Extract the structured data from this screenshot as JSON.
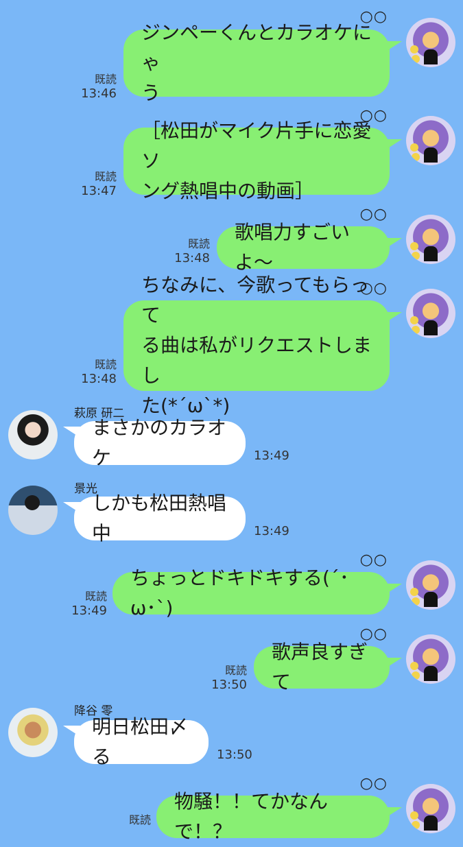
{
  "user_mark": "○○",
  "read_label": "既読",
  "messages": [
    {
      "text": "ジンペーくんとカラオケにゃ\nう",
      "time": "13:46"
    },
    {
      "text": "［松田がマイク片手に恋愛ソ\nング熱唱中の動画］",
      "time": "13:47"
    },
    {
      "text": "歌唱力すごいよ〜",
      "time": "13:48"
    },
    {
      "text": "ちなみに、今歌ってもらって\nる曲は私がリクエストしまし\nた(*´ω`*)",
      "time": "13:48"
    },
    {
      "sender": "萩原 研二",
      "text": "まさかのカラオケ",
      "time": "13:49"
    },
    {
      "sender": "景光",
      "text": "しかも松田熱唱中",
      "time": "13:49"
    },
    {
      "text": "ちょっとドキドキする(´･ω･`)",
      "time": "13:49"
    },
    {
      "text": "歌声良すぎて",
      "time": "13:50"
    },
    {
      "sender": "降谷 零",
      "text": "明日松田〆る",
      "time": "13:50"
    },
    {
      "text": "物騒！！てかなんで！？",
      "time": ""
    }
  ],
  "colors": {
    "background": "#7ab7f7",
    "my_bubble": "#88ef73",
    "their_bubble": "#ffffff"
  }
}
